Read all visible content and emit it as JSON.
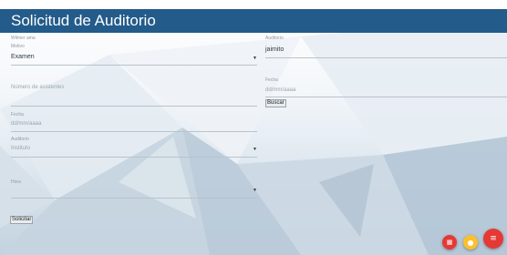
{
  "header": {
    "title": "Solicitud de Auditorio"
  },
  "form_left": {
    "top_label": "Wilmer ama",
    "motivo_label": "Motivo",
    "motivo_value": "Examen",
    "numero_label": "Número de asistentes",
    "fecha_label": "Fecha",
    "fecha_placeholder": "dd/mm/aaaa",
    "auditorio_label": "Auditorio",
    "auditorio_value": "Instituto",
    "hora_label": "Hora",
    "submit_label": "Solicitar"
  },
  "form_right": {
    "usuario_label": "Auditorio",
    "usuario_value": "jaimito",
    "fecha_label": "Fecha",
    "fecha_placeholder": "dd/mm/aaaa",
    "search_label": "Buscar"
  },
  "fabs": {
    "icons": [
      "calendar-icon",
      "person-icon",
      "menu-icon"
    ],
    "colors": [
      "#e53935",
      "#fbc02d",
      "#e53935"
    ]
  }
}
